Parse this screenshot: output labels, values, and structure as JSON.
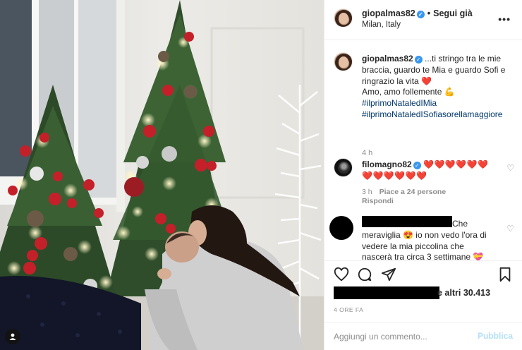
{
  "post": {
    "username": "giopalmas82",
    "follow_state": "Segui già",
    "location": "Milan, Italy"
  },
  "caption": {
    "username": "giopalmas82",
    "text_line1": "...ti stringo tra le mie braccia, guardo te Mia e guardo Sofi e ringrazio la vita",
    "heart": "❤️",
    "text_line2": "Amo, amo follemente",
    "muscle": "💪",
    "hashtags": [
      "#ilprimoNataledIMia",
      "#ilprimoNataledISofiasorellamaggiore"
    ],
    "time": "4 h"
  },
  "comment1": {
    "username": "filomagno82",
    "hearts": "❤️❤️❤️❤️❤️❤️❤️❤️❤️❤️❤️❤️",
    "time": "3 h",
    "likes": "Piace a 24 persone",
    "reply": "Rispondi"
  },
  "comment2": {
    "text": "Che meraviglia 😍 io non vedo l'ora di vedere la mia piccolina che nascerà tra circa 3 settimane 💝"
  },
  "engagement": {
    "likes_suffix": "e altri 30.413",
    "post_time": "4 ORE FA"
  },
  "add_comment": {
    "placeholder": "Aggiungi un commento...",
    "publish_label": "Pubblica"
  },
  "icons": {
    "like": "heart-outline-icon",
    "comment": "comment-bubble-icon",
    "share": "paper-plane-icon",
    "save": "bookmark-icon",
    "more": "more-horizontal-icon",
    "tag": "user-tag-icon"
  },
  "colors": {
    "verified": "#3897f0",
    "hashtag": "#00376b",
    "muted": "#8e8e8e",
    "heart": "#ed4956",
    "publish_disabled": "#b2dffc"
  }
}
